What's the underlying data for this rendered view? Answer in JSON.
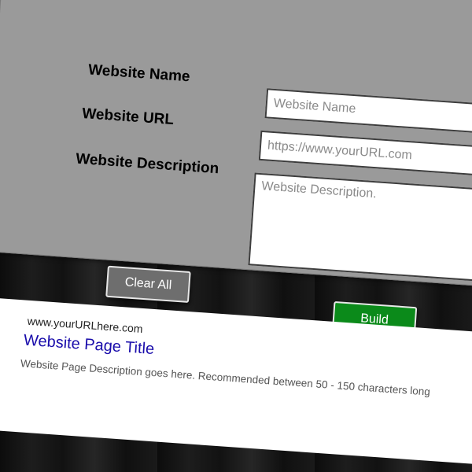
{
  "form": {
    "name_label": "Website Name",
    "url_label": "Website URL",
    "description_label": "Website Description",
    "name_placeholder": "Website Name",
    "url_placeholder": "https://www.yourURL.com",
    "description_placeholder": "Website Description.",
    "clear_button": "Clear All",
    "build_button": "Build"
  },
  "preview": {
    "url": "www.yourURLhere.com",
    "title": "Website Page Title",
    "description": "Website Page Description goes here. Recommended between 50 - 150 characters long"
  },
  "colors": {
    "panel": "#9a9a9a",
    "build_button": "#0b8a1a",
    "clear_button": "#6e6e6e",
    "link_title": "#1a0dab"
  }
}
